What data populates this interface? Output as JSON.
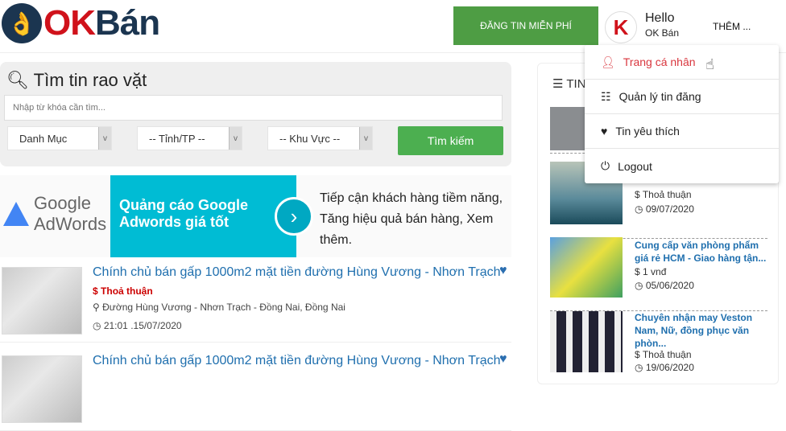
{
  "header": {
    "logo_ok": "OK",
    "logo_ban": "Bán",
    "post_button": "ĐĂNG TIN MIỄN PHÍ",
    "avatar_text": "K",
    "hello": "Hello",
    "user_name": "OK Bán",
    "more": "THÊM ..."
  },
  "search": {
    "title": "Tìm tin rao vặt",
    "placeholder": "Nhập từ khóa cần tìm...",
    "category": "Danh Mục",
    "province": "-- Tỉnh/TP --",
    "area": "-- Khu Vực --",
    "button": "Tìm kiếm"
  },
  "banner": {
    "brand_google": "Google",
    "brand_adwords": "AdWords",
    "headline": "Quảng cáo Google Adwords giá tốt",
    "description": "Tiếp cận khách hàng tiềm năng, Tăng hiệu quả bán hàng, Xem thêm."
  },
  "listings": [
    {
      "title": "Chính chủ bán gấp 1000m2 mặt tiền đường Hùng Vương - Nhơn Trạch",
      "price": "Thoả thuận",
      "location": "Đường Hùng Vương - Nhơn Trạch - Đồng Nai, Đồng Nai",
      "time": "21:01 .15/07/2020"
    },
    {
      "title": "Chính chủ bán gấp 1000m2 mặt tiền đường Hùng Vương - Nhơn Trạch"
    }
  ],
  "sidebar": {
    "title": "TIN",
    "items": [
      {
        "title": "",
        "price": "",
        "date": ""
      },
      {
        "title": "",
        "price": "Thoả thuận",
        "date": "09/07/2020"
      },
      {
        "title": "Cung cấp văn phòng phẩm giá rẻ HCM - Giao hàng tận...",
        "price": "1 vnđ",
        "date": "05/06/2020"
      },
      {
        "title": "Chuyên nhận may Veston Nam, Nữ, đồng phục văn phòn...",
        "price": "Thoả thuận",
        "date": "19/06/2020"
      }
    ]
  },
  "dropdown": {
    "items": [
      {
        "label": "Trang cá nhân",
        "icon": "user-icon"
      },
      {
        "label": "Quản lý tin đăng",
        "icon": "list-icon"
      },
      {
        "label": "Tin yêu thích",
        "icon": "heart-icon"
      },
      {
        "label": "Logout",
        "icon": "power-icon"
      }
    ]
  },
  "colors": {
    "brand_red": "#d0121b",
    "brand_navy": "#1b3550",
    "green": "#4e9d44",
    "link_blue": "#1f6fae",
    "ads_cyan": "#00bcd4"
  }
}
